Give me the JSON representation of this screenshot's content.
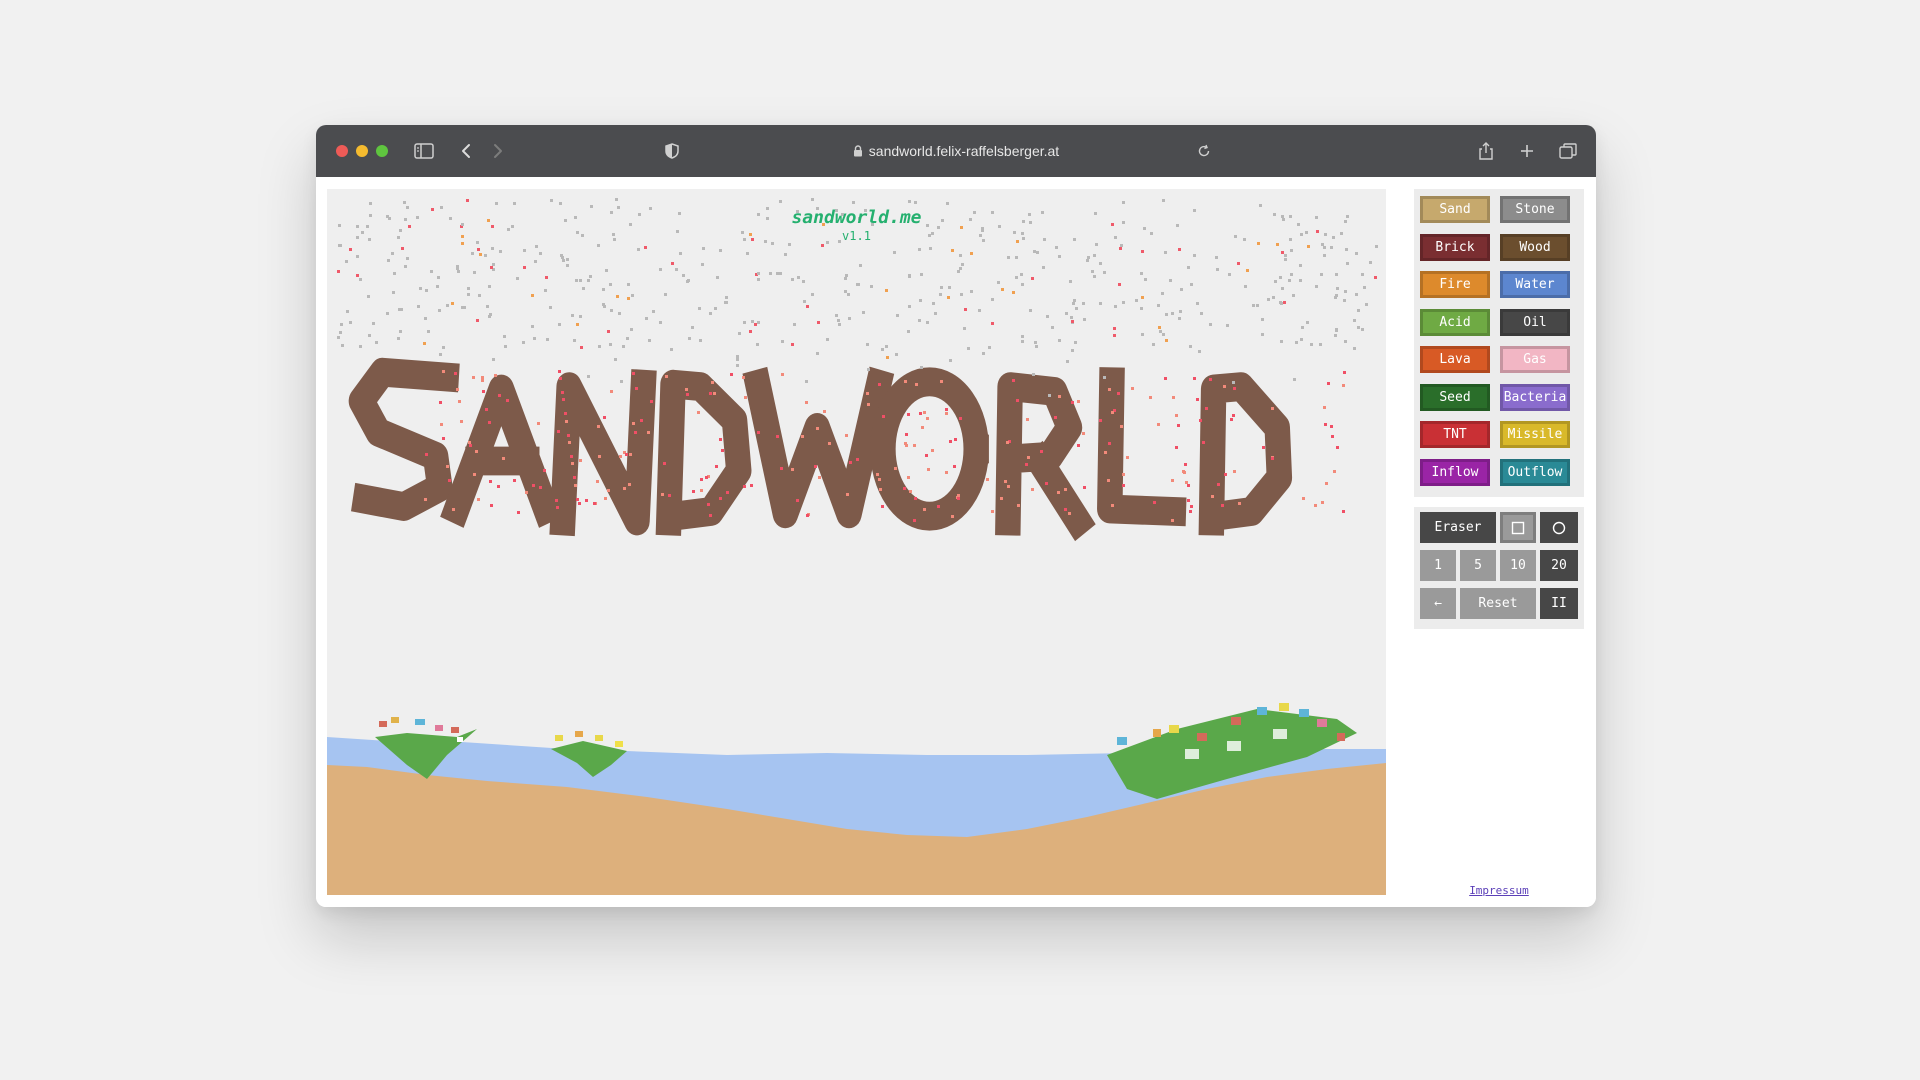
{
  "browser": {
    "url": "sandworld.felix-raffelsberger.at"
  },
  "game": {
    "title": "sandworld.me",
    "version": "v1.1",
    "canvas_word": "SANDWORLD"
  },
  "materials": [
    {
      "label": "Sand",
      "color": "#c6a96d",
      "text": "#ffffff"
    },
    {
      "label": "Stone",
      "color": "#8c8c8c",
      "text": "#ffffff"
    },
    {
      "label": "Brick",
      "color": "#7a2e31",
      "text": "#ffffff"
    },
    {
      "label": "Wood",
      "color": "#6b4e2e",
      "text": "#ffffff"
    },
    {
      "label": "Fire",
      "color": "#dd8a2c",
      "text": "#ffffff"
    },
    {
      "label": "Water",
      "color": "#5c86cf",
      "text": "#ffffff"
    },
    {
      "label": "Acid",
      "color": "#6faa44",
      "text": "#ffffff"
    },
    {
      "label": "Oil",
      "color": "#474747",
      "text": "#ffffff"
    },
    {
      "label": "Lava",
      "color": "#d85a25",
      "text": "#ffffff"
    },
    {
      "label": "Gas",
      "color": "#f2b6c4",
      "text": "#ffffff"
    },
    {
      "label": "Seed",
      "color": "#2a6e2a",
      "text": "#ffffff"
    },
    {
      "label": "Bacteria",
      "color": "#8a6ccd",
      "text": "#ffffff"
    },
    {
      "label": "TNT",
      "color": "#c93035",
      "text": "#ffffff"
    },
    {
      "label": "Missile",
      "color": "#d9b92a",
      "text": "#ffffff"
    },
    {
      "label": "Inflow",
      "color": "#9a24a6",
      "text": "#ffffff"
    },
    {
      "label": "Outflow",
      "color": "#2a8a96",
      "text": "#ffffff"
    }
  ],
  "controls": {
    "eraser": "Eraser",
    "brush_shapes": [
      "square-icon",
      "circle-icon"
    ],
    "sizes": [
      "1",
      "5",
      "10",
      "20"
    ],
    "selected_size": "20",
    "back": "←",
    "reset": "Reset",
    "pause": "II"
  },
  "footer": {
    "impressum": "Impressum"
  },
  "colors": {
    "titlebar": "#4b4c4f",
    "sand_ground": "#ddb07c",
    "water": "#a6c4f1",
    "letters": "#7d5a4a",
    "plant": "#5aa84a",
    "brand_green": "#25b06f"
  }
}
